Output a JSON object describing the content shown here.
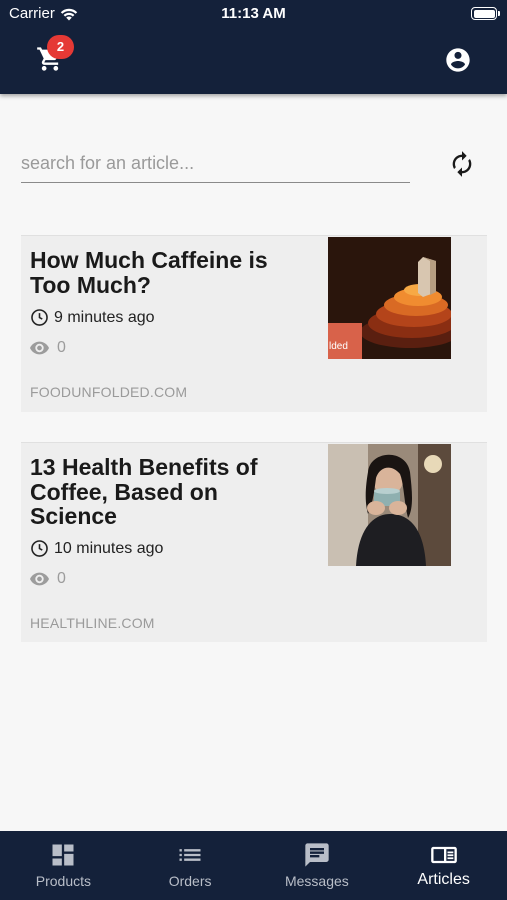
{
  "status_bar": {
    "carrier": "Carrier",
    "time": "11:13 AM"
  },
  "header": {
    "cart_icon": "shopping-cart-icon",
    "cart_count": "2",
    "account_icon": "account-circle-icon"
  },
  "search": {
    "placeholder": "search for an article...",
    "value": "",
    "refresh_icon": "refresh-icon"
  },
  "articles": [
    {
      "title": "How Much Caffeine is Too Much?",
      "time": "9 minutes ago",
      "views": "0",
      "source": "FOODUNFOLDED.COM",
      "thumb_text": "lded"
    },
    {
      "title": "13 Health Benefits of Coffee, Based on Science",
      "time": "10 minutes ago",
      "views": "0",
      "source": "HEALTHLINE.COM"
    }
  ],
  "tabs": [
    {
      "label": "Products",
      "icon": "dashboard-icon"
    },
    {
      "label": "Orders",
      "icon": "list-icon"
    },
    {
      "label": "Messages",
      "icon": "message-icon"
    },
    {
      "label": "Articles",
      "icon": "article-icon",
      "active": true
    }
  ],
  "colors": {
    "header_bg": "#14213a",
    "badge": "#e53935",
    "card_bg": "#eeeeee"
  }
}
